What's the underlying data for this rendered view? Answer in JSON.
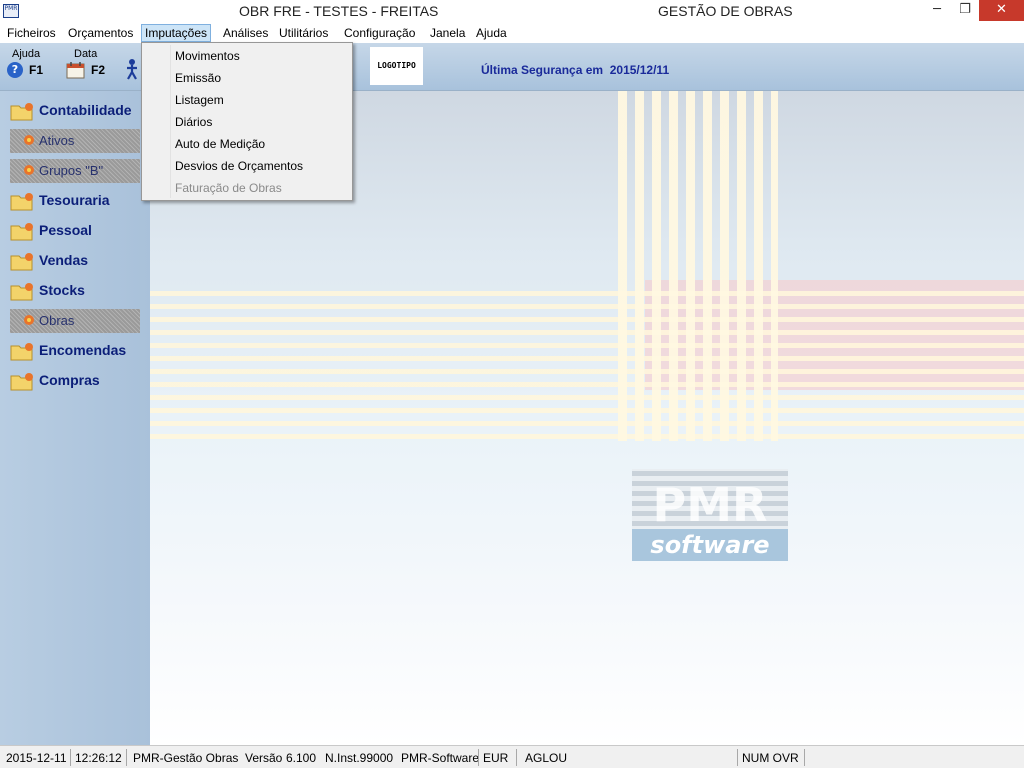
{
  "window": {
    "app_icon_text": "PMR",
    "title": "OBR FRE - TESTES - FREITAS",
    "module": "GESTÃO DE OBRAS",
    "minimize": "─",
    "maximize": "❐",
    "close": "✕"
  },
  "menubar": {
    "items": [
      {
        "label": "Ficheiros"
      },
      {
        "label": "Orçamentos"
      },
      {
        "label": "Imputações",
        "active": true
      },
      {
        "label": "Análises"
      },
      {
        "label": "Utilitários"
      },
      {
        "label": "Configuração"
      },
      {
        "label": "Janela"
      },
      {
        "label": "Ajuda"
      }
    ]
  },
  "dropdown": {
    "items": [
      {
        "label": "Movimentos",
        "enabled": true
      },
      {
        "label": "Emissão",
        "enabled": true
      },
      {
        "label": "Listagem",
        "enabled": true
      },
      {
        "label": "Diários",
        "enabled": true
      },
      {
        "label": "Auto de Medição",
        "enabled": true
      },
      {
        "label": "Desvios de Orçamentos",
        "enabled": true
      },
      {
        "label": "Faturação de Obras",
        "enabled": false
      }
    ]
  },
  "toolbar": {
    "help": {
      "label": "Ajuda",
      "key": "F1",
      "icon": "help-icon"
    },
    "date": {
      "label": "Data",
      "key": "F2",
      "icon": "calendar-icon"
    },
    "logo": "LOGOTIPO",
    "backup_label": "Última Segurança em",
    "backup_date": "2015/12/11"
  },
  "sidebar": {
    "items": [
      {
        "label": "Contabilidade",
        "type": "folder"
      },
      {
        "label": "Ativos",
        "type": "sub"
      },
      {
        "label": "Grupos \"B\"",
        "type": "sub"
      },
      {
        "label": "Tesouraria",
        "type": "folder"
      },
      {
        "label": "Pessoal",
        "type": "folder"
      },
      {
        "label": "Vendas",
        "type": "folder"
      },
      {
        "label": "Stocks",
        "type": "folder"
      },
      {
        "label": "Obras",
        "type": "sub"
      },
      {
        "label": "Encomendas",
        "type": "folder"
      },
      {
        "label": "Compras",
        "type": "folder"
      }
    ]
  },
  "watermark": {
    "brand": "PMR",
    "product": "software"
  },
  "statusbar": {
    "date": "2015-12-11",
    "time": "12:26:12",
    "app": "PMR-Gestão Obras",
    "version_label": "Versão",
    "version": "6.100",
    "installation": "N.Inst.99000",
    "company": "PMR-Software",
    "currency": "EUR",
    "user": "AGLOU",
    "keys": "NUM OVR"
  },
  "colors": {
    "sidebar_text": "#0b1e78",
    "backup_text": "#1a2a9a",
    "menu_active": "#cce4f7",
    "close_button": "#c7392b"
  }
}
